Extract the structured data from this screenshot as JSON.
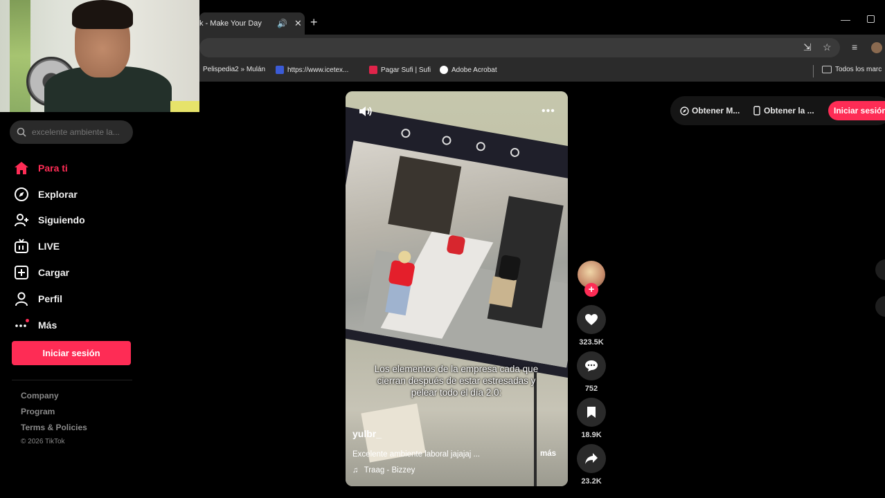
{
  "browser": {
    "tab_title": "k - Make Your Day",
    "bookmarks": [
      {
        "label": "Pelispedia2 » Mulán"
      },
      {
        "label": "https://www.icetex..."
      },
      {
        "label": "Pagar Sufi | Sufi"
      },
      {
        "label": "Adobe Acrobat"
      },
      {
        "label": "Todos los marc"
      }
    ]
  },
  "sidebar": {
    "search_placeholder": "excelente ambiente la...",
    "nav": [
      {
        "label": "Para ti",
        "icon": "home-icon",
        "active": true
      },
      {
        "label": "Explorar",
        "icon": "compass-icon"
      },
      {
        "label": "Siguiendo",
        "icon": "following-icon"
      },
      {
        "label": "LIVE",
        "icon": "live-icon"
      },
      {
        "label": "Cargar",
        "icon": "upload-icon"
      },
      {
        "label": "Perfil",
        "icon": "profile-icon"
      },
      {
        "label": "Más",
        "icon": "more-icon"
      }
    ],
    "login_label": "Iniciar sesión",
    "footer": {
      "company": "Company",
      "program": "Program",
      "terms": "Terms & Policies",
      "copyright": "© 2026 TikTok"
    }
  },
  "topbar": {
    "get_app_1": "Obtener M...",
    "get_app_2": "Obtener la ...",
    "login_label": "Iniciar sesión"
  },
  "video": {
    "caption": "Los elementos de la empresa cada que cierran después de estar estresadas y pelear todo el día 2.0:",
    "author": "yulbr_",
    "description": "Excelente ambiente laboral jajajaj ...",
    "more_label": "más",
    "music": "Traag - Bizzey"
  },
  "actions": {
    "likes": "323.5K",
    "comments": "752",
    "saves": "18.9K",
    "shares": "23.2K"
  },
  "colors": {
    "accent": "#fe2c55",
    "background": "#000000"
  }
}
